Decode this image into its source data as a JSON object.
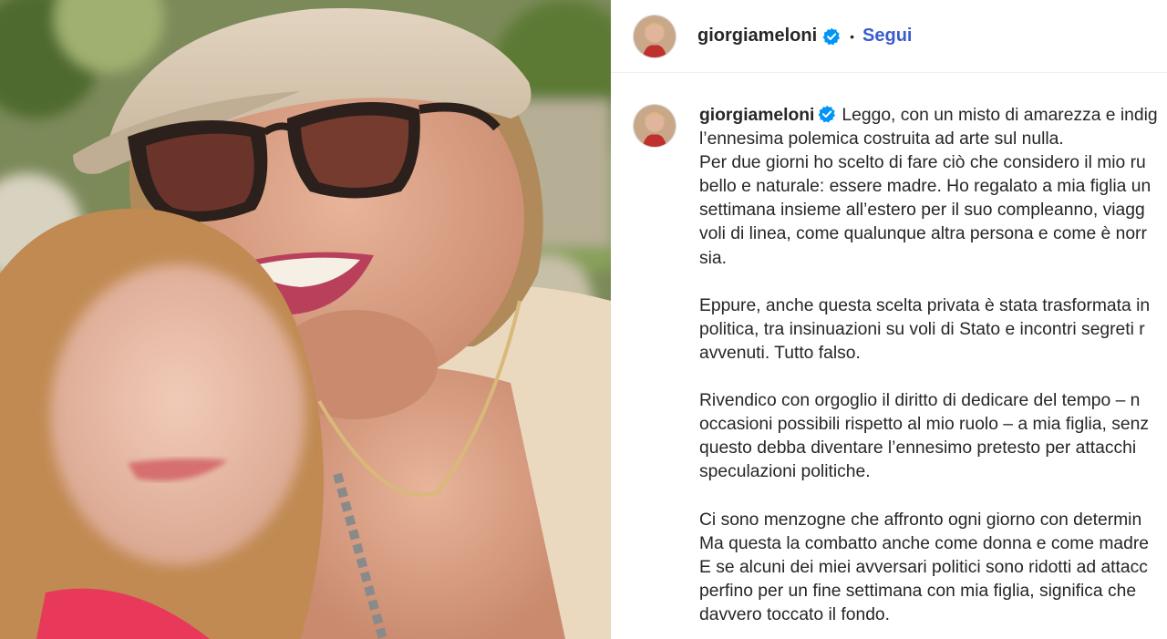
{
  "post": {
    "author": {
      "username": "giorgiameloni",
      "verified_icon": "verified-badge-icon",
      "follow_label": "Segui",
      "separator": "•"
    },
    "caption": {
      "lines": [
        "Leggo, con un misto di amarezza e indig",
        "l’ennesima polemica costruita ad arte sul nulla.",
        "Per due giorni ho scelto di fare ciò che considero il mio ru",
        "bello e naturale: essere madre. Ho regalato a mia figlia un",
        "settimana insieme all’estero per il suo compleanno, viagg",
        "voli di linea, come qualunque altra persona e come è norr",
        "sia.",
        "",
        "Eppure, anche questa scelta privata è stata trasformata in",
        "politica, tra insinuazioni su voli di Stato e incontri segreti r",
        "avvenuti. Tutto falso.",
        "",
        "Rivendico con orgoglio il diritto di dedicare del tempo – n",
        "occasioni possibili rispetto al mio ruolo – a mia figlia, senz",
        "questo debba diventare l’ennesimo pretesto per attacchi",
        "speculazioni politiche.",
        "",
        "Ci sono menzogne che affronto ogni giorno con determin",
        "Ma questa la combatto anche come donna e come madre",
        "E se alcuni dei miei avversari politici sono ridotti ad attacc",
        "perfino per un fine settimana con mia figlia, significa che",
        "davvero toccato il fondo."
      ]
    },
    "colors": {
      "follow": "#3a5ccc",
      "verified": "#0095f6",
      "text": "#262626"
    }
  }
}
